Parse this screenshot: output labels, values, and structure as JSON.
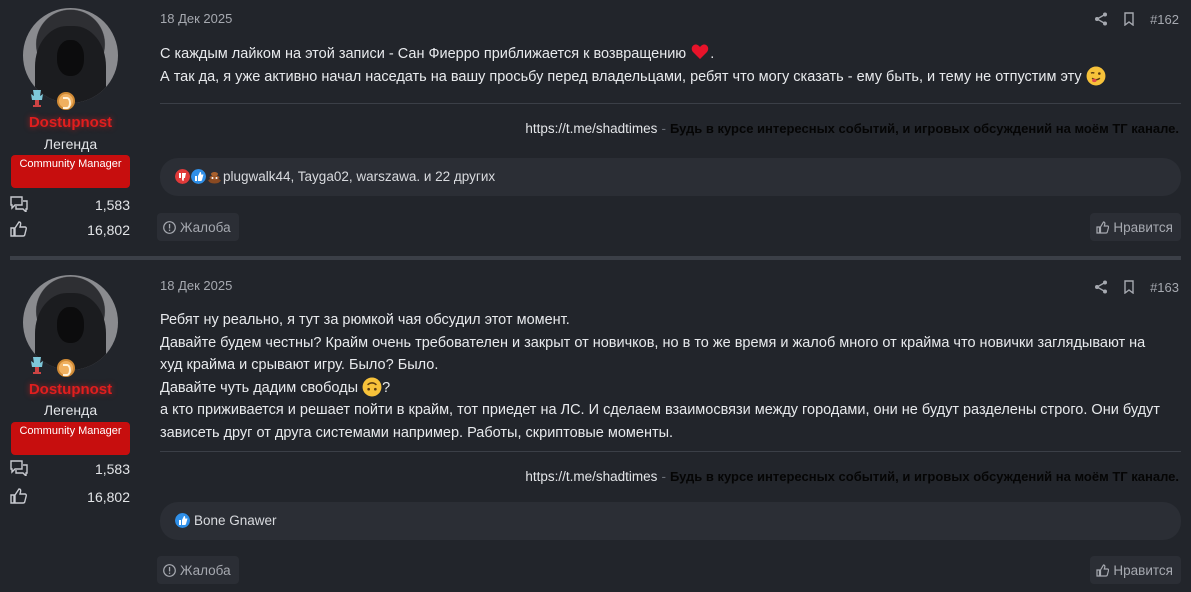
{
  "posts": [
    {
      "user": {
        "name": "Dostupnost",
        "title": "Легенда",
        "role": "Community Manager",
        "messages": "1,583",
        "reactions": "16,802"
      },
      "date": "18 Дек 2025",
      "number": "#162",
      "lines": [
        "С каждым лайком на этой записи - Сан Фиерро приближается к возвращению",
        ".",
        "А так да, я уже активно начал наседать на вашу просьбу перед владельцами, ребят что могу сказать - ему быть, и тему не отпустим эту"
      ],
      "signature": {
        "link": "https://t.me/shadtimes",
        "dash": "-",
        "text": "Будь в курсе интересных событий, и игровых обсуждений на моём ТГ канале."
      },
      "reactions_text": "plugwalk44, Tayga02, warszawa. и 22 других",
      "report_label": "Жалоба",
      "like_label": "Нравится"
    },
    {
      "user": {
        "name": "Dostupnost",
        "title": "Легенда",
        "role": "Community Manager",
        "messages": "1,583",
        "reactions": "16,802"
      },
      "date": "18 Дек 2025",
      "number": "#163",
      "lines": [
        "Ребят ну реально, я тут за рюмкой чая обсудил этот момент.",
        "Давайте будем честны? Крайм очень требователен и закрыт от новичков, но в то же время и жалоб много от крайма что новички заглядывают на",
        "худ крайма и срывают игру. Было? Было.",
        "Давайте чуть дадим свободы",
        "?",
        "а кто приживается и решает пойти в крайм, тот приедет на ЛС. И сделаем взаимосвязи между городами, они не будут разделены строго. Они будут",
        "зависеть друг от друга системами например. Работы, скриптовые моменты."
      ],
      "signature": {
        "link": "https://t.me/shadtimes",
        "dash": "-",
        "text": "Будь в курсе интересных событий, и игровых обсуждений на моём ТГ канале."
      },
      "reactions_text": "Bone Gnawer",
      "report_label": "Жалоба",
      "like_label": "Нравится"
    }
  ],
  "icons": [
    "share-icon",
    "bookmark-icon",
    "messages-icon",
    "thumbs-up-icon",
    "report-icon",
    "heart-emoji",
    "wink-emoji",
    "upside-down-emoji"
  ],
  "colors": {
    "background": "#22252b",
    "panel": "#2b2e35",
    "username": "#e01e1e",
    "role_badge": "#c70e0e",
    "like_reaction": "#2f8fe8"
  }
}
